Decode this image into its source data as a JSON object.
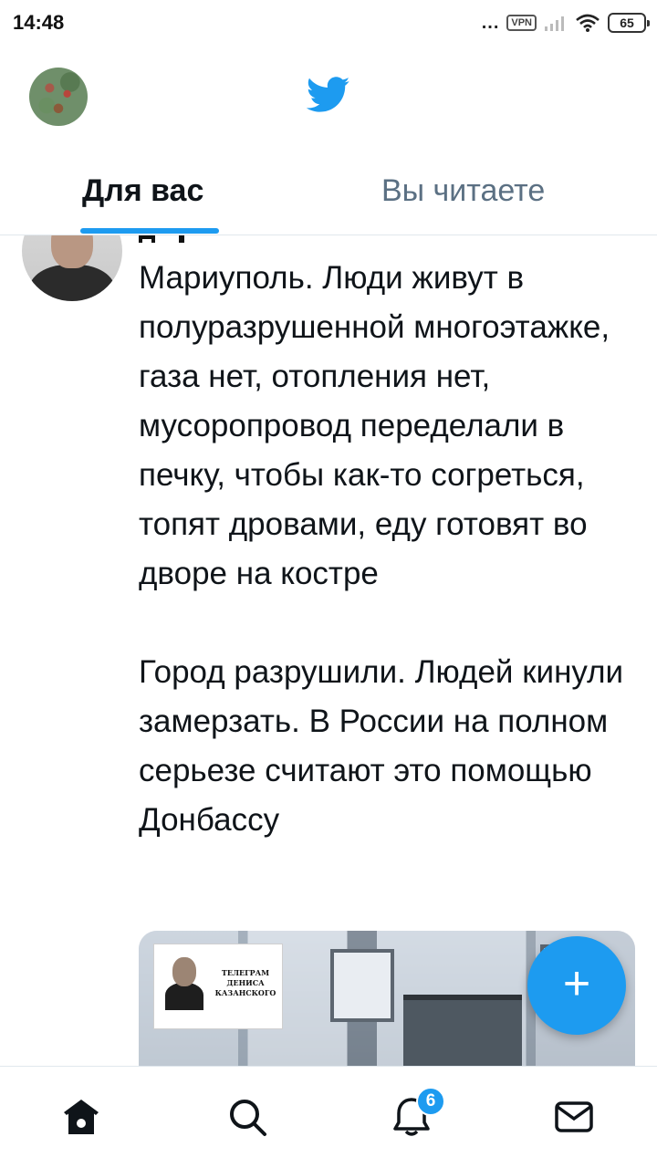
{
  "status_bar": {
    "time": "14:48",
    "dots": "...",
    "vpn": "VPN",
    "battery": "65"
  },
  "header": {
    "profile_icon": "profile-avatar",
    "logo_icon": "twitter-bird-icon",
    "accent_color": "#1d9bf0"
  },
  "tabs": {
    "for_you": "Для вас",
    "following": "Вы читаете",
    "active": "for_you"
  },
  "tweet": {
    "text": "Мариуполь. Люди живут в полуразрушенной многоэтажке, газа нет, отопления нет, мусоропровод переделали в печку, чтобы как-то согреться, топят дровами, еду готовят во дворе на костре\n\nГород разрушили. Людей кинули замерзать. В России на полном серьезе считают это помощью Донбассу",
    "media_badge": "ТЕЛЕГРАМ ДЕНИСА КАЗАНСКОГО"
  },
  "fab": {
    "label": "+"
  },
  "bottom_nav": {
    "items": [
      {
        "icon": "home-icon",
        "active": true
      },
      {
        "icon": "search-icon",
        "active": false
      },
      {
        "icon": "bell-icon",
        "active": false
      },
      {
        "icon": "mail-icon",
        "active": false
      }
    ],
    "notifications_badge": "6"
  }
}
